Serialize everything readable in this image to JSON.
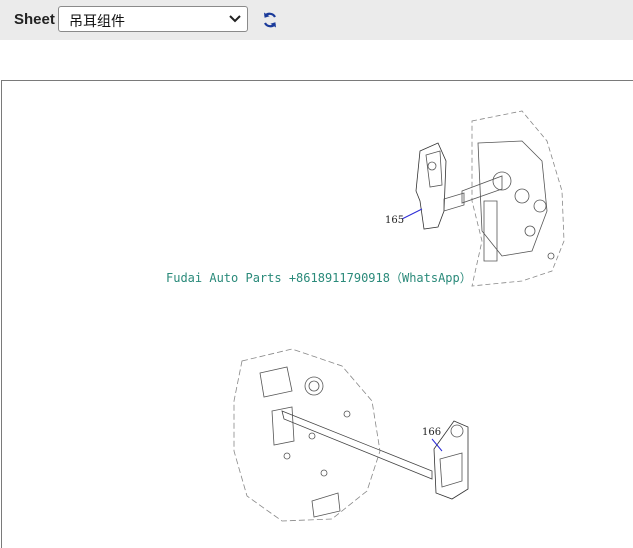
{
  "toolbar": {
    "sheet_label": "Sheet",
    "sheet_value": "吊耳组件",
    "refresh_icon": "refresh-icon"
  },
  "drawing": {
    "watermark": "Fudai Auto Parts +8618911790918（WhatsApp）",
    "callouts": [
      "165",
      "166"
    ]
  },
  "colors": {
    "toolbar_bg": "#ebebeb",
    "refresh_blue": "#1a3a9a",
    "watermark": "#2a8a7a",
    "leader": "#2b2bd6"
  }
}
